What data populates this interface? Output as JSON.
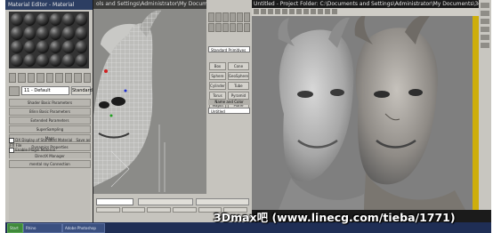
{
  "material_editor": {
    "title": "Material Editor - Material",
    "name_field": "11 - Default",
    "type_button": "Standard",
    "rollouts": [
      "Shader Basic Parameters",
      "Blinn Basic Parameters",
      "Extended Parameters",
      "SuperSampling",
      "Maps",
      "Dynamics Properties",
      "DirectX Manager"
    ],
    "dx_option": "DX Display of Standard Material",
    "save_fx": "Save as .FX File",
    "enable_plugin": "Enable Plugin Material",
    "lower_rollout": "mental ray Connection"
  },
  "viewport_left": {
    "title": "ols and Settings\\Administrator\\My Documents\\3dsmax"
  },
  "command_panel": {
    "dropdown": "Standard Primitives",
    "object_type_buttons": [
      "Box",
      "Cone",
      "Sphere",
      "GeoSphere",
      "Cylinder",
      "Tube",
      "Torus",
      "Pyramid",
      "Teapot",
      "Plane"
    ],
    "section_label": "Name and Color",
    "name_value": "Untitled"
  },
  "viewport_right": {
    "title": "Untitled   - Project Folder: C:\\Documents and Settings\\Administrator\\My Documents\\3dsmax"
  },
  "taskbar": {
    "items": [
      "Start",
      "Rhino",
      "Adobe Photoshop"
    ]
  },
  "watermark": "3Dmax吧 (www.linecg.com/tieba/1771)"
}
